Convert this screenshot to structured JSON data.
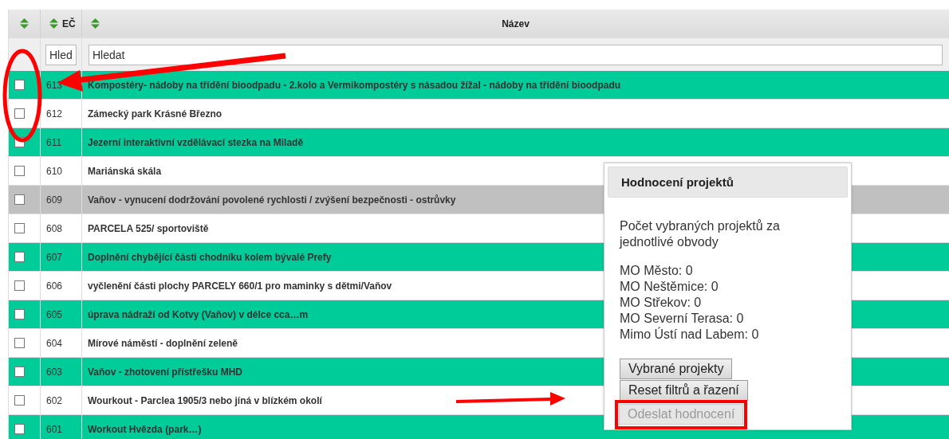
{
  "table": {
    "columns": [
      {
        "kind": "select"
      },
      {
        "kind": "text",
        "label": "EČ"
      },
      {
        "kind": "text",
        "label": "Název"
      }
    ],
    "filters": [
      {
        "placeholder": "Hled"
      },
      {
        "placeholder": "Hledat"
      }
    ],
    "rows": [
      {
        "number": "613",
        "name": "Kompostéry- nádoby na třídění bioodpadu - 2.kolo a Vermikompostéry s násadou žížal - nádoby na třídění bioodpadu",
        "color": "#00cc99",
        "checked": false
      },
      {
        "number": "612",
        "name": "Zámecký park Krásné Březno",
        "color": "#ffffff",
        "checked": false
      },
      {
        "number": "611",
        "name": "Jezerní interaktivní vzdělávací stezka na Miladě",
        "color": "#00cc99",
        "checked": false
      },
      {
        "number": "610",
        "name": "Mariánská skála",
        "color": "#ffffff",
        "checked": false
      },
      {
        "number": "609",
        "name": "Vaňov - vynucení dodržování povolené rychlosti / zvýšení bezpečnosti - ostrůvky",
        "color": "#c0c0c0",
        "checked": false
      },
      {
        "number": "608",
        "name": "PARCELA 525/ sportoviště",
        "color": "#ffffff",
        "checked": false
      },
      {
        "number": "607",
        "name": "Doplnění chybějící části chodníku kolem bývalé Prefy",
        "color": "#00cc99",
        "checked": false
      },
      {
        "number": "606",
        "name": "vyčlenění části plochy PARCELY 660/1 pro maminky s dětmi/Vaňov",
        "color": "#ffffff",
        "checked": false
      },
      {
        "number": "605",
        "name": "úprava nádraží od Kotvy (Vaňov) v délce cca…m",
        "color": "#00cc99",
        "checked": false
      },
      {
        "number": "604",
        "name": "Mírové náměstí - doplnění zeleně",
        "color": "#ffffff",
        "checked": false
      },
      {
        "number": "603",
        "name": "Vaňov - zhotovení přístřešku MHD",
        "color": "#00cc99",
        "checked": false
      },
      {
        "number": "602",
        "name": "Wourkout - Parclea 1905/3 nebo jíná v blízkém okolí",
        "color": "#ffffff",
        "checked": false
      },
      {
        "number": "601",
        "name": "Workout Hvězda (park…)",
        "color": "#00cc99",
        "checked": false
      }
    ]
  },
  "panel": {
    "title": "Hodnocení projektů",
    "description": "Počet vybraných projektů za jednotlivé obvody",
    "counts": [
      "MO Město: 0",
      "MO Neštěmice: 0",
      "MO Střekov: 0",
      "MO Severní Terasa: 0",
      "Mimo Ústí nad Labem: 0"
    ],
    "buttons": [
      {
        "label": "Vybrané projekty",
        "disabled": false,
        "highlighted": false
      },
      {
        "label": "Reset filtrů a řazení",
        "disabled": false,
        "highlighted": false
      },
      {
        "label": "Odeslat hodnocení",
        "disabled": true,
        "highlighted": true
      }
    ]
  },
  "annotations": [
    {
      "kind": "ellipse"
    },
    {
      "kind": "arrow-left"
    },
    {
      "kind": "arrow-right"
    }
  ]
}
